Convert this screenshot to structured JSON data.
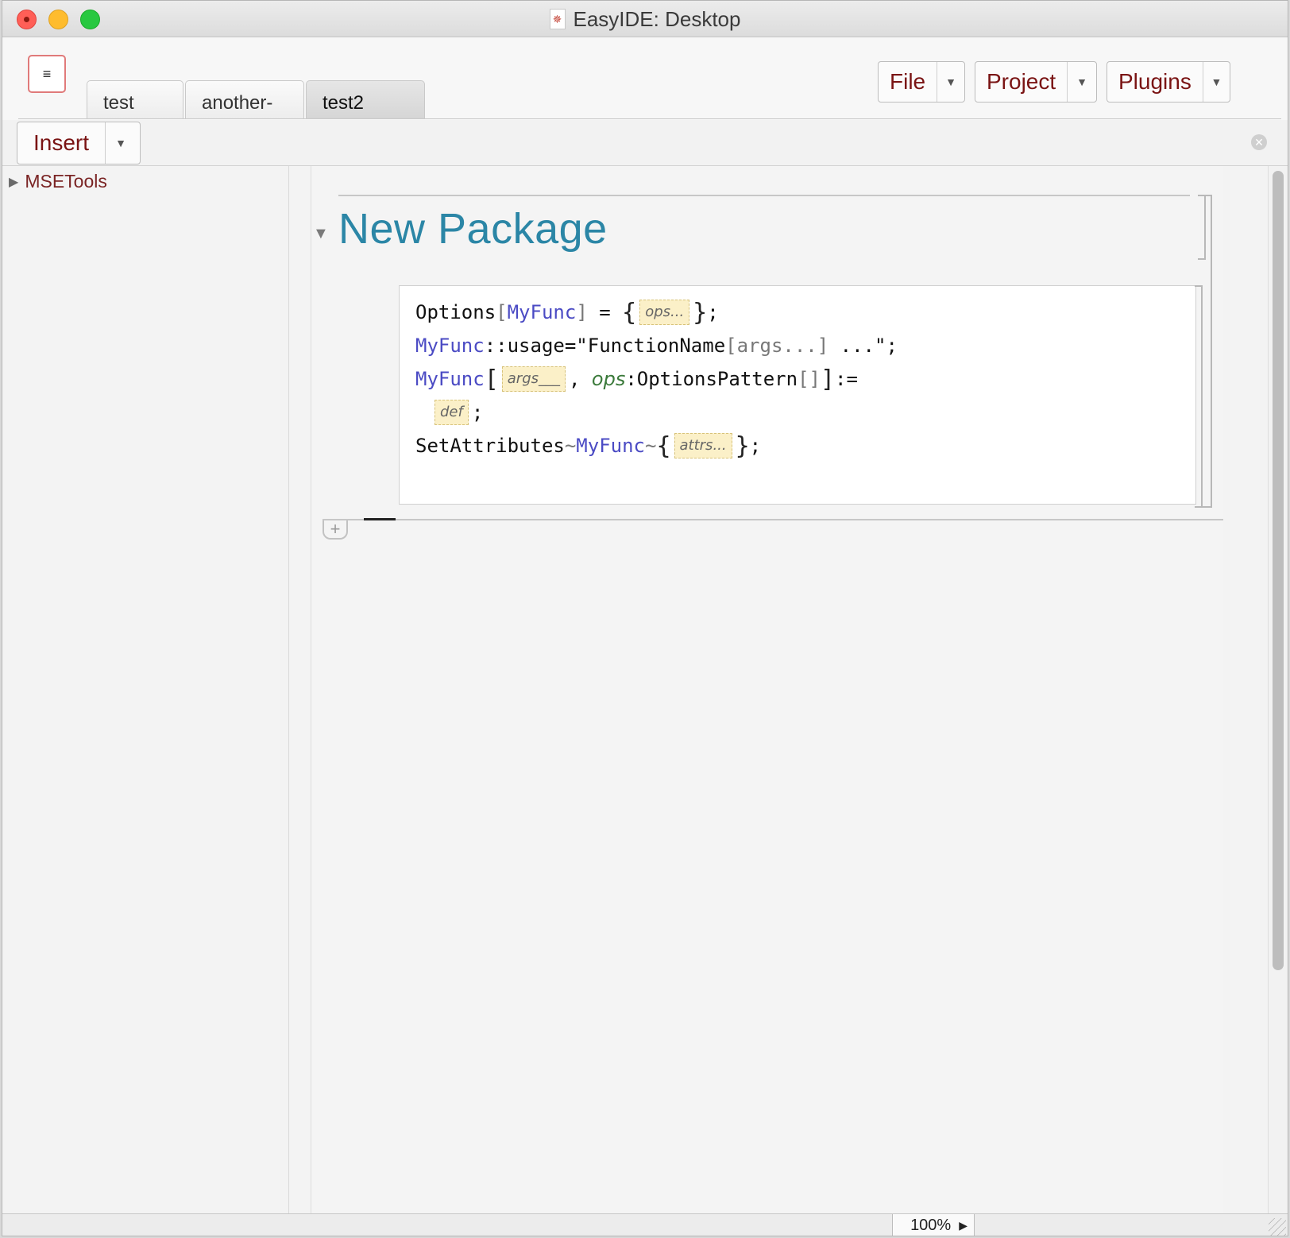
{
  "window": {
    "title": "EasyIDE: Desktop"
  },
  "toolbar": {
    "menu_glyph": "≡",
    "tabs": [
      {
        "label": "test"
      },
      {
        "label": "another-"
      },
      {
        "label": "test2"
      }
    ],
    "file_label": "File",
    "project_label": "Project",
    "plugins_label": "Plugins",
    "insert_label": "Insert"
  },
  "sidebar": {
    "items": [
      {
        "label": "MSETools"
      }
    ]
  },
  "notebook": {
    "heading": "New Package",
    "code": {
      "l1": {
        "a": "Options",
        "b": "[",
        "c": "MyFunc",
        "d": "]",
        "e": " = ",
        "f": "{",
        "g": "ops...",
        "h": "}",
        "i": ";"
      },
      "l2": {
        "a": "MyFunc",
        "b": "::usage=\"FunctionName",
        "c": "[",
        "d": "args...",
        "e": "]",
        "f": " ...\";"
      },
      "l3": {
        "a": "MyFunc",
        "b": "[",
        "c": "args___",
        "d": ", ",
        "e": "ops",
        "f": ":OptionsPattern",
        "g": "[]",
        "h": "]",
        "i": ":="
      },
      "l4": {
        "a": "def",
        "b": ";"
      },
      "l5": {
        "a": "SetAttributes",
        "b": "~",
        "c": "MyFunc",
        "d": "~",
        "e": "{",
        "f": "attrs...",
        "g": "}",
        "h": ";"
      }
    }
  },
  "status": {
    "zoom": "100%"
  },
  "colors": {
    "accent": "#2b86a6",
    "button_text": "#7a1414",
    "keyword": "#4b4bc4"
  }
}
